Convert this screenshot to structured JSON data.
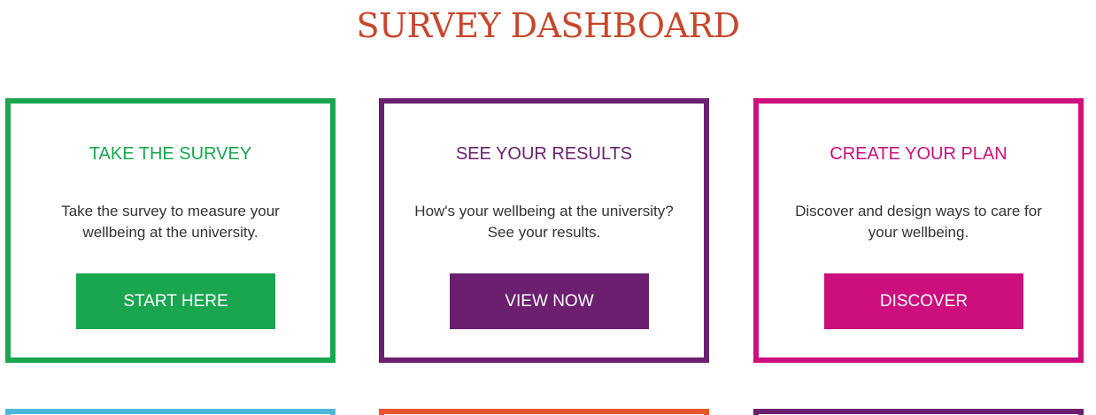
{
  "page": {
    "title": "SURVEY DASHBOARD",
    "title_color": "#c8472b"
  },
  "cards": [
    {
      "heading": "TAKE THE SURVEY",
      "description": "Take the survey to measure your wellbeing at the university.",
      "button_label": "START HERE",
      "color": "#1aa64e"
    },
    {
      "heading": "SEE YOUR RESULTS",
      "description": "How's your wellbeing at the university? See your results.",
      "button_label": "VIEW NOW",
      "color": "#6b1f6e"
    },
    {
      "heading": "CREATE YOUR PLAN",
      "description": "Discover and design ways to care for your wellbeing.",
      "button_label": "DISCOVER",
      "color": "#cc0f7d"
    }
  ],
  "bottom_cards": [
    {
      "color": "#4cb7d9"
    },
    {
      "color": "#e8552a"
    },
    {
      "color": "#6b1f6e"
    }
  ]
}
